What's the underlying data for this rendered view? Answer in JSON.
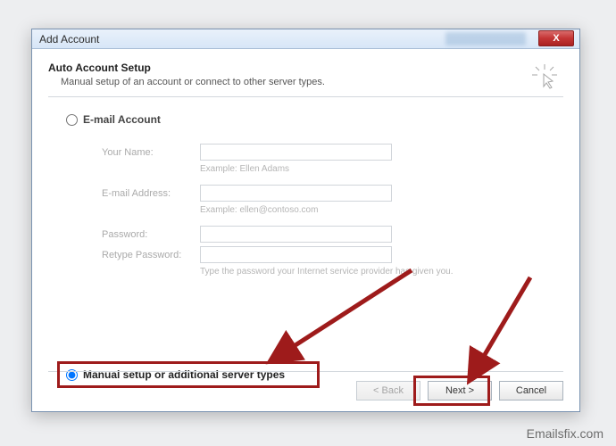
{
  "window": {
    "title": "Add Account"
  },
  "header": {
    "title": "Auto Account Setup",
    "subtitle": "Manual setup of an account or connect to other server types."
  },
  "options": {
    "email_account_label": "E-mail Account",
    "manual_setup_label": "Manual setup or additional server types"
  },
  "form": {
    "name_label": "Your Name:",
    "name_value": "",
    "name_example": "Example: Ellen Adams",
    "email_label": "E-mail Address:",
    "email_value": "",
    "email_example": "Example: ellen@contoso.com",
    "password_label": "Password:",
    "password_value": "",
    "retype_label": "Retype Password:",
    "retype_value": "",
    "password_hint": "Type the password your Internet service provider has given you."
  },
  "footer": {
    "back_label": "< Back",
    "next_label": "Next >",
    "cancel_label": "Cancel"
  },
  "watermark": "Emailsfix.com",
  "close_glyph": "X"
}
